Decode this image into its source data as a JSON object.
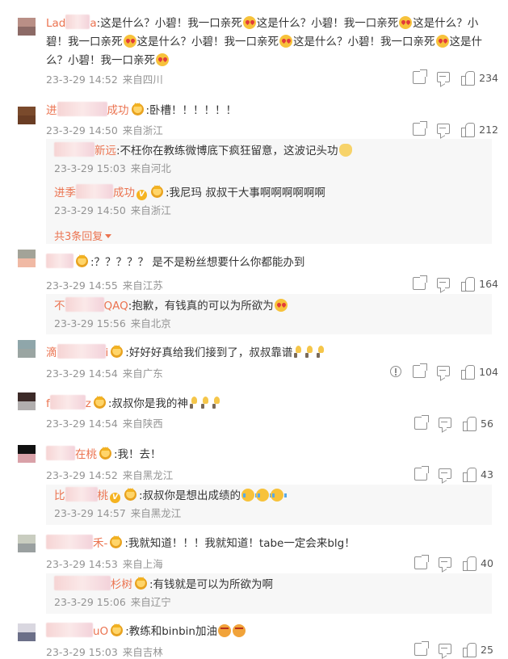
{
  "comments": [
    {
      "user_start": "Lad",
      "user_end": "a",
      "text": "这是什么？小碧！我一口亲死这是什么？小碧！我一口亲死这是什么？小碧！我一口亲死这是什么？小碧！我一口亲死这是什么？小碧！我一口亲死这是什么？小碧！我一口亲死",
      "date": "23-3-29 14:52",
      "location": "来自四川",
      "likes": "234",
      "avatar": [
        "#b98f86",
        "#8c6a66"
      ]
    },
    {
      "user_start": "进",
      "user_end": "成功",
      "text": ":卧槽！！！！！！",
      "date": "23-3-29 14:50",
      "location": "来自浙江",
      "likes": "212",
      "avatar": [
        "#7a4a2c",
        "#6a3d24"
      ],
      "replies": [
        {
          "user_end": "新远",
          "text": ":不枉你在教练微博底下疯狂留意，这波记头功",
          "date": "23-3-29 15:03",
          "location": "来自河北"
        },
        {
          "user_start": "进季",
          "user_end": "成功",
          "text": ":我尼玛 叔叔干大事啊啊啊啊啊啊",
          "date": "23-3-29 14:50",
          "location": "来自浙江"
        }
      ],
      "more_replies": "共3条回复"
    },
    {
      "user_start": "",
      "user_end": "",
      "text": ":？？？？？ 是不是粉丝想要什么你都能办到",
      "date": "23-3-29 14:55",
      "location": "来自江苏",
      "likes": "164",
      "avatar": [
        "#a3a398",
        "#f0b9a4"
      ],
      "replies": [
        {
          "user_start": "不",
          "user_end": "QAQ",
          "text": ":抱歉，有钱真的可以为所欲为",
          "date": "23-3-29 15:56",
          "location": "来自北京"
        }
      ]
    },
    {
      "user_start": "滴",
      "user_end": "i",
      "text": ":好好好真给我们接到了，叔叔靠谱",
      "date": "23-3-29 14:54",
      "location": "来自广东",
      "likes": "104",
      "avatar": [
        "#8fa6aa",
        "#9aa5a2"
      ]
    },
    {
      "user_start": "f",
      "user_end": "z",
      "text": ":叔叔你是我的神",
      "date": "23-3-29 14:54",
      "location": "来自陕西",
      "likes": "56",
      "avatar": [
        "#3c2a28",
        "#b1aeae"
      ]
    },
    {
      "user_start": "",
      "user_end": "在桃",
      "text": ":我！去！",
      "date": "23-3-29 14:52",
      "location": "来自黑龙江",
      "likes": "43",
      "avatar": [
        "#111111",
        "#d9a1a8"
      ],
      "replies": [
        {
          "user_start": "比",
          "user_end": "桃",
          "text": ":叔叔你是想出成绩的",
          "date": "23-3-29 14:57",
          "location": "来自黑龙江"
        }
      ]
    },
    {
      "user_start": "",
      "user_end": "禾-",
      "text": ":我就知道！！！我就知道！tabe一定会来blg！",
      "date": "23-3-29 14:53",
      "location": "来自上海",
      "likes": "40",
      "avatar": [
        "#c9cdc0",
        "#9aa0a0"
      ],
      "replies": [
        {
          "user_start": "",
          "user_end": "杉树",
          "text": ":有钱就是可以为所欲为啊",
          "date": "23-3-29 15:06",
          "location": "来自辽宁"
        }
      ]
    },
    {
      "user_start": "",
      "user_end": "uO",
      "text": ":教练和binbin加油",
      "date": "23-3-29 15:03",
      "location": "来自吉林",
      "likes": "25",
      "avatar": [
        "#d9d7e0",
        "#6b6f88"
      ]
    }
  ]
}
